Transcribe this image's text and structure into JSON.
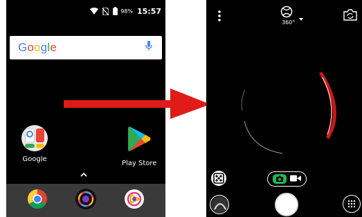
{
  "status_bar": {
    "battery_percent": "98%",
    "time": "15:57"
  },
  "home": {
    "search_logo": "Google",
    "apps": [
      {
        "label": "Google"
      },
      {
        "label": "Play Store"
      }
    ]
  },
  "camera": {
    "mode_label": "360°"
  },
  "colors": {
    "arrow": "#e11a1a",
    "camera_accent": "#1db954"
  },
  "icons": [
    "wifi-icon",
    "no-sim-icon",
    "battery-icon",
    "google-g-logo",
    "mic-icon",
    "google-folder-icon",
    "play-store-icon",
    "chevron-up-icon",
    "chrome-icon",
    "camera-app-icon",
    "photos-app-icon",
    "more-vert-icon",
    "360-mode-icon",
    "switch-camera-icon",
    "vr-layout-icon",
    "photo-mode-icon",
    "video-mode-icon",
    "shutter-button",
    "gallery-thumbnail",
    "apps-grid-icon"
  ]
}
